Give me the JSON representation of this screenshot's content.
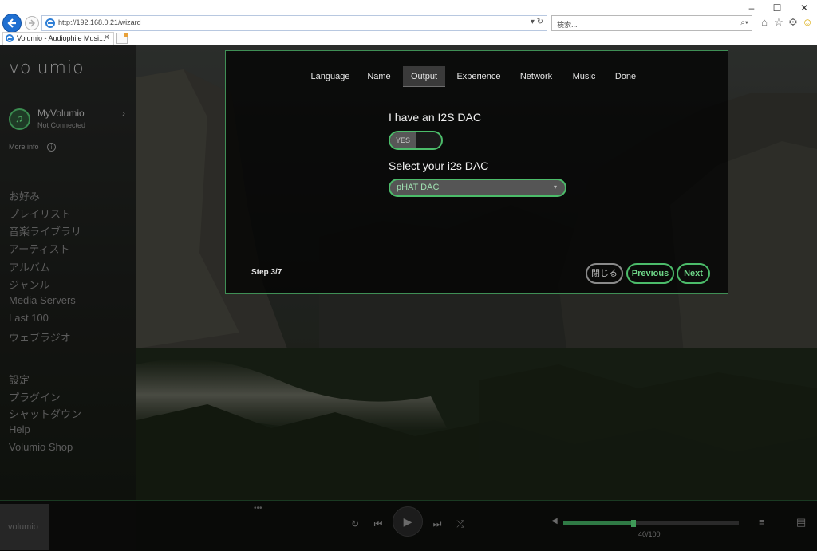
{
  "browser": {
    "window_controls": {
      "minimize": "–",
      "maximize": "☐",
      "close": "✕"
    },
    "address": "http://192.168.0.21/wizard",
    "address_icons": "▾ ↻",
    "search_placeholder": "検索...",
    "search_icon_glyph": "⌕▾",
    "tab_title": "Volumio - Audiophile Musi...",
    "tab_close": "✕",
    "tool_icons": {
      "home": "⌂",
      "favorites": "☆",
      "settings": "⚙",
      "feedback": "☺"
    }
  },
  "sidebar": {
    "logo": "volumio",
    "myvolumio": {
      "title": "MyVolumio",
      "subtitle": "Not Connected",
      "icon_glyph": "♫",
      "chevron": "›"
    },
    "more_info": "More info",
    "info_icon": "i",
    "menu_primary": [
      "お好み",
      "プレイリスト",
      "音楽ライブラリ",
      "アーティスト",
      "アルバム",
      "ジャンル",
      "Media Servers",
      "Last 100",
      "ウェブラジオ"
    ],
    "menu_secondary": [
      "設定",
      "プラグイン",
      "シャットダウン",
      "Help",
      "Volumio Shop"
    ]
  },
  "wizard": {
    "tabs": [
      "Language",
      "Name",
      "Output",
      "Experience",
      "Network",
      "Music",
      "Done"
    ],
    "active_tab": "Output",
    "question_dac": "I have an I2S DAC",
    "toggle_label": "YES",
    "question_select": "Select your i2s DAC",
    "dac_selected": "pHAT DAC",
    "dac_chevron": "▾",
    "step": "Step 3/7",
    "buttons": {
      "close": "閉じる",
      "previous": "Previous",
      "next": "Next"
    }
  },
  "player": {
    "thumb_logo": "volumio",
    "dots": "•••",
    "controls": {
      "repeat": "↻",
      "prev": "⏮",
      "play": "▶",
      "next": "⏭",
      "shuffle": "⤮"
    },
    "volume_icon": "◀",
    "volume": 40,
    "volume_max": 100,
    "volume_text": "40/100",
    "queue_icon": "≡",
    "library_icon": "▤"
  },
  "colors": {
    "accent": "#4cbc6a",
    "accent_text": "#6fd889",
    "sidebar_text": "#5c5c5c"
  }
}
